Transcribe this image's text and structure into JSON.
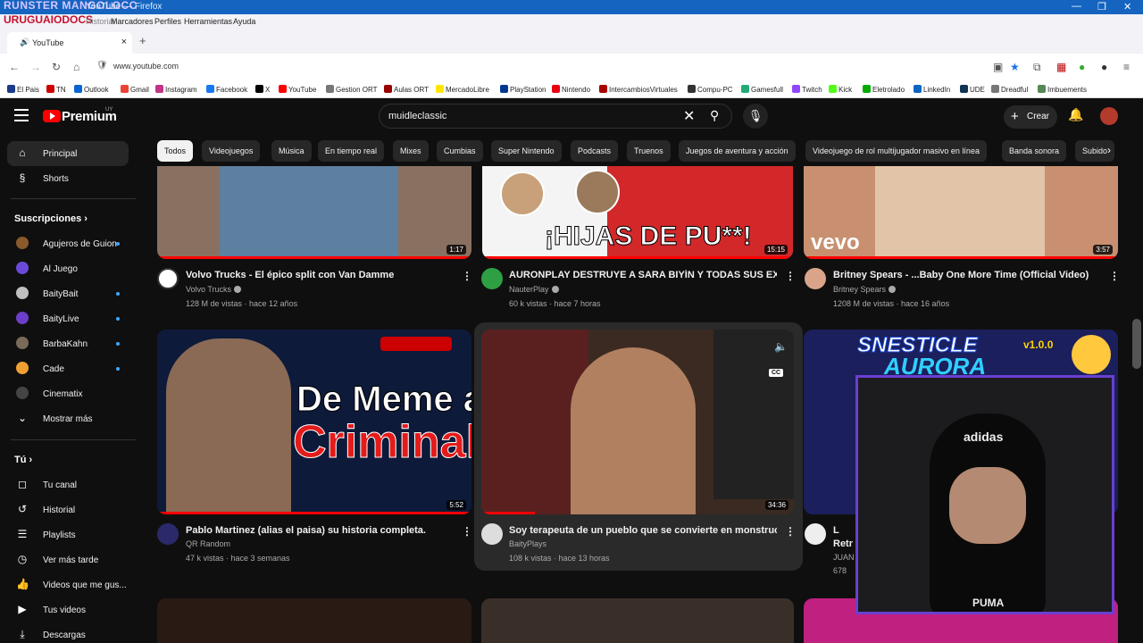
{
  "browser": {
    "overlay_top": "RUNSTER MANGOLOCC",
    "window_title": "YouTube — Firefox",
    "overlay_brand": "URUGUAIODOCS",
    "menu": [
      "Historial",
      "Marcadores",
      "Perfiles",
      "Herramientas",
      "Ayuda"
    ],
    "tab_title": "YouTube",
    "tab_close": "×",
    "new_tab": "+",
    "url": "www.youtube.com",
    "bookmarks": [
      "El Pais",
      "TN",
      "Outlook",
      "Gmail",
      "Instagram",
      "Facebook",
      "X",
      "YouTube",
      "Gestion ORT",
      "Aulas ORT",
      "MercadoLibre",
      "PlayStation",
      "Nintendo",
      "IntercambiosVirtuales",
      "Compu-PC",
      "Gamesfull",
      "Twitch",
      "Kick",
      "Eletrolado",
      "LinkedIn",
      "UDE",
      "Dreadful",
      "Imbuements"
    ]
  },
  "youtube": {
    "logo": "Premium",
    "country": "UY",
    "search_query": "muidleclassic",
    "create_label": "Crear",
    "chips": [
      "Todos",
      "Videojuegos",
      "Música",
      "En tiempo real",
      "Mixes",
      "Cumbias",
      "Super Nintendo",
      "Podcasts",
      "Truenos",
      "Juegos de aventura y acción",
      "Videojuego de rol multijugador masivo en línea",
      "Banda sonora",
      "Subido"
    ]
  },
  "sidebar": {
    "top": [
      {
        "label": "Principal"
      },
      {
        "label": "Shorts"
      }
    ],
    "subs_header": "Suscripciones",
    "subs": [
      {
        "label": "Agujeros de Guion",
        "color": "#8a5a2b"
      },
      {
        "label": "Al Juego",
        "color": "#6a4ad8"
      },
      {
        "label": "BaityBait",
        "color": "#c0c0c0"
      },
      {
        "label": "BaityLive",
        "color": "#6b3fc9"
      },
      {
        "label": "BarbaKahn",
        "color": "#7a6a5a"
      },
      {
        "label": "Cade",
        "color": "#f0a030"
      },
      {
        "label": "Cinematix",
        "color": "#444444"
      }
    ],
    "more": "Mostrar más",
    "you_header": "Tú",
    "you": [
      {
        "label": "Tu canal"
      },
      {
        "label": "Historial"
      },
      {
        "label": "Playlists"
      },
      {
        "label": "Ver más tarde"
      },
      {
        "label": "Videos que me gus..."
      },
      {
        "label": "Tus videos"
      },
      {
        "label": "Descargas"
      }
    ]
  },
  "videos": [
    {
      "title": "Volvo Trucks - El épico split con Van Damme",
      "channel": "Volvo Trucks",
      "meta": "128 M de vistas · hace 12 años",
      "duration": "1:17",
      "thumb_color": "#8a7060"
    },
    {
      "title": "AURONPLAY DESTRUYE A SARA BIYÍN Y TODAS SUS EX, CINE",
      "channel": "NauterPlay",
      "meta": "60 k vistas · hace 7 horas",
      "duration": "15:15",
      "thumb_text": "¡HIJAS DE PU**!",
      "thumb_color": "#d2282a"
    },
    {
      "title": "Britney Spears - ...Baby One More Time (Official Video)",
      "channel": "Britney Spears",
      "meta": "1208 M de vistas · hace 16 años",
      "duration": "3:57",
      "thumb_text": "vevo",
      "thumb_color": "#c89070"
    },
    {
      "title": "Pablo Martinez (alias el paisa) su historia completa.",
      "channel": "QR Random",
      "meta": "47 k vistas · hace 3 semanas",
      "duration": "5:52",
      "thumb_text1": "De Meme a",
      "thumb_text2": "Criminal",
      "thumb_color": "#1a1a1a"
    },
    {
      "title": "Soy terapeuta de un pueblo que se convierte en monstruos",
      "channel": "BaityPlays",
      "meta": "108 k vistas · hace 13 horas",
      "duration": "34:36",
      "thumb_color": "#3a2a22",
      "cc": "CC"
    },
    {
      "title": "L",
      "channel": "JUAN",
      "meta": "678",
      "duration": "",
      "thumb_text1": "SNESTICLE",
      "thumb_text2": "AURORA",
      "thumb_text3": "v1.0.0",
      "thumb_color": "#1b1f5c",
      "title2": "Retr"
    }
  ],
  "webcam_brand": "adidas",
  "webcam_brand2": "PUMA"
}
